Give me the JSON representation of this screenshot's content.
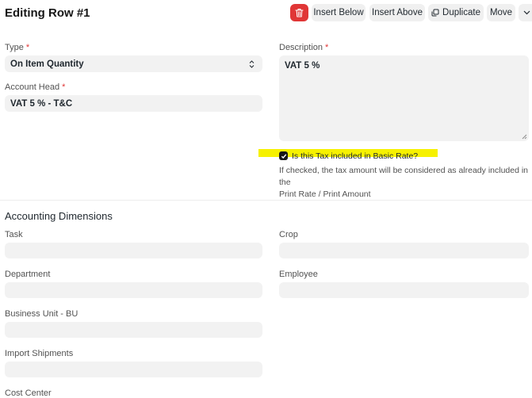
{
  "header": {
    "title": "Editing Row #1",
    "buttons": {
      "insert_below": "Insert Below",
      "insert_above": "Insert Above",
      "duplicate": "Duplicate",
      "move": "Move"
    }
  },
  "form": {
    "type": {
      "label": "Type",
      "required": "*",
      "value": "On Item Quantity"
    },
    "account_head": {
      "label": "Account Head",
      "required": "*",
      "value": "VAT 5 % - T&C"
    },
    "description": {
      "label": "Description",
      "required": "*",
      "value": "VAT 5 %"
    },
    "included_in_rate": {
      "label": "Is this Tax included in Basic Rate?",
      "checked": true,
      "help_line1": "If checked, the tax amount will be considered as already included in the",
      "help_line2": "Print Rate / Print Amount"
    }
  },
  "accounting_dimensions": {
    "title": "Accounting Dimensions",
    "task": "Task",
    "crop": "Crop",
    "department": "Department",
    "employee": "Employee",
    "business_unit": "Business Unit - BU",
    "import_shipments": "Import Shipments",
    "cost_center": "Cost Center"
  },
  "colors": {
    "delete_button": "#e03636",
    "highlight": "#f6f100",
    "field_bg": "#f2f2f2"
  }
}
